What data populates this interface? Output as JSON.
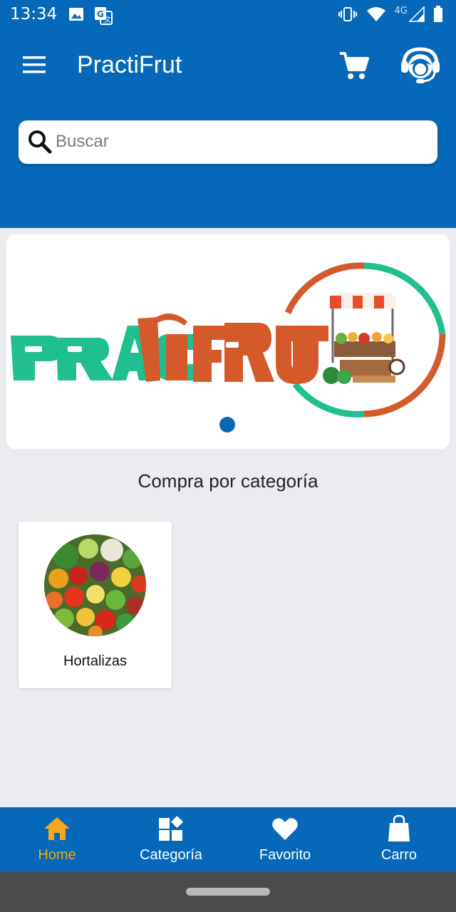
{
  "status_bar": {
    "time": "13:34",
    "network_label": "4G",
    "icons": [
      "image-icon",
      "translate-icon",
      "vibrate-icon",
      "wifi-icon",
      "signal-icon",
      "battery-icon"
    ]
  },
  "app_bar": {
    "title": "PractiFrut",
    "icons": [
      "menu-icon",
      "cart-icon",
      "support-agent-icon"
    ]
  },
  "search": {
    "placeholder": "Buscar",
    "value": ""
  },
  "banner": {
    "logo_text": "PRACTIFRUT",
    "slide_count": 1,
    "active_slide": 1
  },
  "categories": {
    "title": "Compra por categoría",
    "items": [
      {
        "label": "Hortalizas",
        "image": "vegetables-image"
      }
    ]
  },
  "bottom_nav": {
    "items": [
      {
        "label": "Home",
        "icon": "home-icon",
        "active": true
      },
      {
        "label": "Categoría",
        "icon": "category-icon",
        "active": false
      },
      {
        "label": "Favorito",
        "icon": "heart-icon",
        "active": false
      },
      {
        "label": "Carro",
        "icon": "shopping-bag-icon",
        "active": false
      }
    ]
  },
  "colors": {
    "primary": "#0568b8",
    "accent_active": "#f3a91b",
    "background": "#ebecef",
    "logo_green": "#1fbf8f",
    "logo_orange": "#d45a2c"
  }
}
